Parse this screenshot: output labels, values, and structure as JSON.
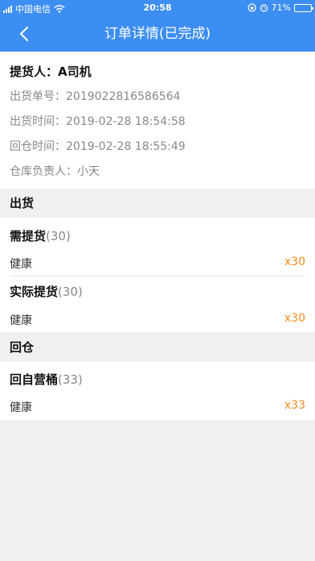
{
  "status_bar": {
    "carrier": "中国电信",
    "time": "20:58",
    "battery": "71%",
    "battery_level": 0.71
  },
  "nav": {
    "title": "订单详情(已完成)"
  },
  "info": {
    "picker": "提货人：A司机",
    "order_no": "出货单号：2019022816586564",
    "out_time": "出货时间：2019-02-28 18:54:58",
    "return_time": "回仓时间：2019-02-28 18:55:49",
    "manager": "仓库负责人：小天"
  },
  "sections": {
    "out": {
      "title": "出货",
      "groups": [
        {
          "name": "需提货",
          "count": "(30)",
          "item": "健康",
          "qty": "x30"
        },
        {
          "name": "实际提货",
          "count": "(30)",
          "item": "健康",
          "qty": "x30"
        }
      ]
    },
    "return": {
      "title": "回仓",
      "groups": [
        {
          "name": "回自营桶",
          "count": "(33)",
          "item": "健康",
          "qty": "x33"
        }
      ]
    }
  },
  "colors": {
    "primary": "#3d8ef2",
    "quantity": "#f08c1e"
  }
}
